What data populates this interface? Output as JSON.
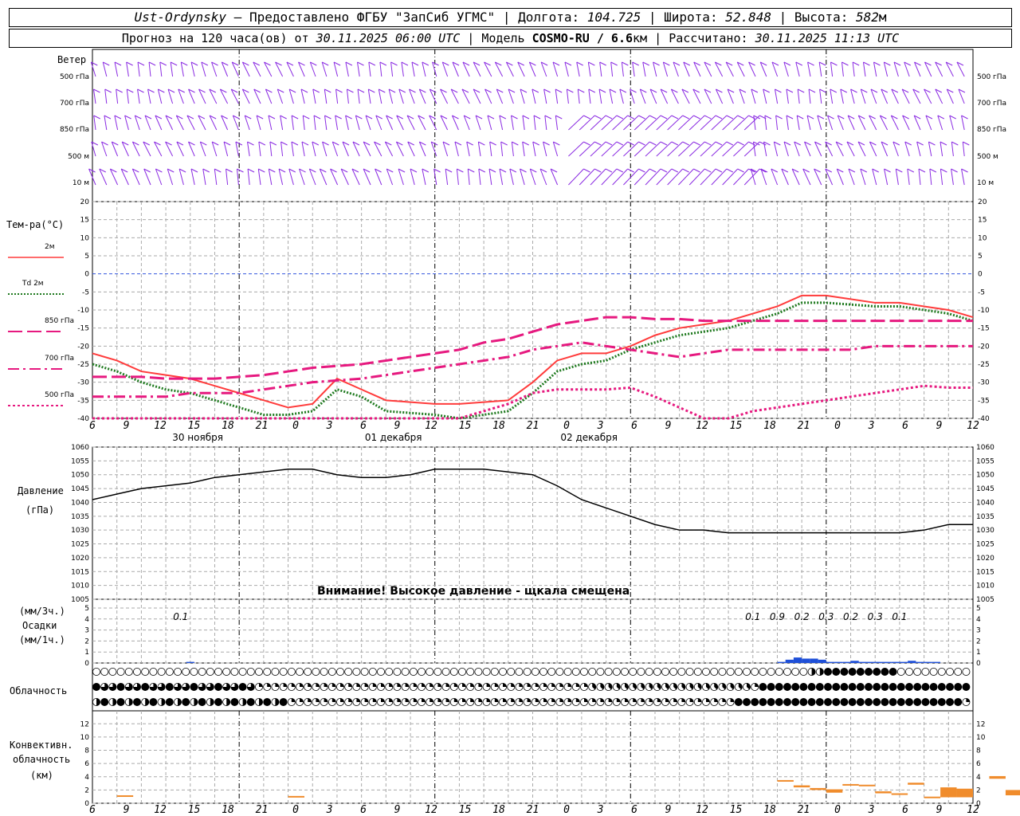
{
  "header": {
    "station": "Ust-Ordynsky",
    "provider": "Предоставлено ФГБУ \"ЗапСиб УГМС\"",
    "lon_label": "Долгота:",
    "lon": "104.725",
    "lat_label": "Широта:",
    "lat": "52.848",
    "alt_label": "Высота:",
    "alt": "582",
    "alt_unit": "м",
    "forecast_label": "Прогноз на 120 часа(ов) от",
    "forecast_from": "30.11.2025 06:00 UTC",
    "model_label": "Модель",
    "model": "COSMO-RU / 6.6",
    "model_unit": "км",
    "computed_label": "Рассчитано:",
    "computed": "30.11.2025 11:13 UTC"
  },
  "wind_panel": {
    "title": "Ветер",
    "levels": [
      "500 гПа",
      "700 гПа",
      "850 гПа",
      "500 м",
      "10 м"
    ],
    "color": "#8a2be2"
  },
  "temp_panel": {
    "title": "Тем-ра(°С)",
    "legend": [
      {
        "label": "2м",
        "color": "#ff3b3b",
        "style": "solid"
      },
      {
        "label": "Td 2м",
        "color": "#1f7a1f",
        "style": "dotted"
      },
      {
        "label": "850 гПа",
        "color": "#e6197f",
        "style": "dash"
      },
      {
        "label": "700 гПа",
        "color": "#e6197f",
        "style": "dashdot"
      },
      {
        "label": "500 гПа",
        "color": "#e6197f",
        "style": "dot"
      }
    ],
    "yticks": [
      20,
      15,
      10,
      5,
      0,
      -5,
      -10,
      -15,
      -20,
      -25,
      -30,
      -35,
      -40
    ]
  },
  "dates": [
    "30 ноября",
    "01 декабря",
    "02 декабря"
  ],
  "x_hours": [
    "6",
    "9",
    "12",
    "15",
    "18",
    "21",
    "0",
    "3",
    "6",
    "9",
    "12",
    "15",
    "18",
    "21",
    "0",
    "3",
    "6",
    "9",
    "12",
    "15",
    "18",
    "21",
    "0",
    "3",
    "6",
    "9",
    "12"
  ],
  "pressure_panel": {
    "title": "Давление",
    "unit": "(гПа)",
    "yticks": [
      1060,
      1055,
      1050,
      1045,
      1040,
      1035,
      1030,
      1025,
      1020,
      1015,
      1010,
      1005
    ],
    "note": "Внимание! Высокое давление - щкала смещена"
  },
  "precip_panel": {
    "unit3": "(мм/3ч.)",
    "title": "Осадки",
    "unit1": "(мм/1ч.)",
    "yticks": [
      5,
      4,
      3,
      2,
      1,
      0
    ],
    "labels": [
      {
        "hour": 15,
        "text": "0.1"
      },
      {
        "hour": 84,
        "text": "0.1"
      },
      {
        "hour": 87,
        "text": "0.9"
      },
      {
        "hour": 90,
        "text": "0.2"
      },
      {
        "hour": 93,
        "text": "0.3"
      },
      {
        "hour": 96,
        "text": "0.2"
      },
      {
        "hour": 99,
        "text": "0.3"
      },
      {
        "hour": 102,
        "text": "0.1"
      }
    ],
    "color": "#1e4fd8"
  },
  "cloud_panel": {
    "title": "Облачность"
  },
  "conv_panel": {
    "title1": "Конвективн.",
    "title2": "облачность",
    "unit": "(км)",
    "yticks": [
      12,
      10,
      8,
      6,
      4,
      2,
      0
    ],
    "color": "#f08c2c"
  },
  "chart_data": [
    {
      "type": "line",
      "title": "Тем-ра(°С)",
      "x_hours_from_start": [
        0,
        3,
        6,
        9,
        12,
        15,
        18,
        21,
        24,
        27,
        30,
        33,
        36,
        39,
        42,
        45,
        48,
        51,
        54,
        57,
        60,
        63,
        66,
        69,
        72,
        75,
        78,
        81,
        84,
        87,
        90,
        93,
        96,
        99,
        102,
        105,
        108
      ],
      "ylim": [
        -40,
        20
      ],
      "series": [
        {
          "name": "2м",
          "values": [
            -22,
            -24,
            -27,
            -28,
            -29,
            -31,
            -33,
            -35,
            -37,
            -36,
            -29,
            -32,
            -35,
            -35.5,
            -36,
            -36,
            -35.5,
            -35,
            -30,
            -24,
            -22,
            -22,
            -20,
            -17,
            -15,
            -14,
            -13,
            -11,
            -9,
            -6,
            -6,
            -7,
            -8,
            -8,
            -9,
            -10,
            -12
          ]
        },
        {
          "name": "Td 2м",
          "values": [
            -25,
            -27,
            -30,
            -32,
            -33,
            -35,
            -37,
            -39,
            -39,
            -38,
            -32,
            -34,
            -38,
            -38.5,
            -39,
            -40,
            -39,
            -38,
            -33,
            -27,
            -25,
            -24,
            -21,
            -19,
            -17,
            -16,
            -15,
            -13,
            -11,
            -8,
            -8,
            -8.5,
            -9,
            -9,
            -10,
            -11,
            -13
          ]
        },
        {
          "name": "850 гПа",
          "values": [
            -28.5,
            -28.5,
            -28.5,
            -29,
            -29,
            -29,
            -28.5,
            -28,
            -27,
            -26,
            -25.5,
            -25,
            -24,
            -23,
            -22,
            -21,
            -19,
            -18,
            -16,
            -14,
            -13,
            -12,
            -12,
            -12.5,
            -12.5,
            -13,
            -13,
            -13,
            -13,
            -13,
            -13,
            -13,
            -13,
            -13,
            -13,
            -13,
            -13
          ]
        },
        {
          "name": "700 гПа",
          "values": [
            -34,
            -34,
            -34,
            -34,
            -33,
            -33,
            -33,
            -32,
            -31,
            -30,
            -29.5,
            -29,
            -28,
            -27,
            -26,
            -25,
            -24,
            -23,
            -21,
            -20,
            -19,
            -20,
            -21,
            -22,
            -23,
            -22,
            -21,
            -21,
            -21,
            -21,
            -21,
            -21,
            -20,
            -20,
            -20,
            -20,
            -20
          ]
        },
        {
          "name": "500 гПа",
          "values": [
            -46,
            -46,
            -46,
            -46,
            -46,
            -46,
            -46,
            -46,
            -46,
            -46,
            -46,
            -46,
            -46,
            -46,
            -45,
            -40,
            -38,
            -36,
            -33,
            -32,
            -32,
            -32,
            -31.5,
            -34,
            -37,
            -40,
            -40,
            -38,
            -37,
            -36,
            -35,
            -34,
            -33,
            -32,
            -31,
            -31.5,
            -31.5
          ]
        }
      ]
    },
    {
      "type": "line",
      "title": "Давление",
      "ylabel": "(гПа)",
      "ylim": [
        1005,
        1060
      ],
      "x_hours_from_start": [
        0,
        3,
        6,
        9,
        12,
        15,
        18,
        21,
        24,
        27,
        30,
        33,
        36,
        39,
        42,
        45,
        48,
        51,
        54,
        57,
        60,
        63,
        66,
        69,
        72,
        75,
        78,
        81,
        84,
        87,
        90,
        93,
        96,
        99,
        102,
        105,
        108
      ],
      "series": [
        {
          "name": "Давление",
          "values": [
            1041,
            1043,
            1045,
            1046,
            1047,
            1049,
            1050,
            1051,
            1052,
            1052,
            1050,
            1049,
            1049,
            1050,
            1052,
            1052,
            1052,
            1051,
            1050,
            1046,
            1041,
            1038,
            1035,
            1032,
            1030,
            1030,
            1029,
            1029,
            1029,
            1029,
            1029,
            1029,
            1029,
            1029,
            1030,
            1032,
            1032
          ]
        }
      ]
    },
    {
      "type": "bar",
      "title": "Осадки",
      "x_hours_from_start": [
        84,
        85,
        86,
        87,
        88,
        89,
        90,
        91,
        92,
        93,
        94,
        95,
        96,
        97,
        98,
        99,
        100,
        101,
        102,
        103
      ],
      "values": [
        0.1,
        0.3,
        0.5,
        0.4,
        0.4,
        0.3,
        0.1,
        0.1,
        0.1,
        0.2,
        0.1,
        0.1,
        0.1,
        0.1,
        0.1,
        0.1,
        0.2,
        0.1,
        0.1,
        0.1
      ],
      "ylim": [
        0,
        5
      ]
    },
    {
      "type": "bar",
      "title": "Конвективн. облачность",
      "ylabel": "(км)",
      "ylim": [
        0,
        13
      ],
      "segments": [
        {
          "hour": 3,
          "base": 1.0,
          "top": 1.2
        },
        {
          "hour": 24,
          "base": 0.9,
          "top": 1.1
        },
        {
          "hour": 84,
          "base": 3.3,
          "top": 3.5
        },
        {
          "hour": 86,
          "base": 2.4,
          "top": 2.7
        },
        {
          "hour": 88,
          "base": 2.0,
          "top": 2.3
        },
        {
          "hour": 90,
          "base": 1.6,
          "top": 2.1
        },
        {
          "hour": 92,
          "base": 2.7,
          "top": 2.9
        },
        {
          "hour": 94,
          "base": 2.6,
          "top": 2.8
        },
        {
          "hour": 96,
          "base": 1.5,
          "top": 1.8
        },
        {
          "hour": 98,
          "base": 1.3,
          "top": 1.5
        },
        {
          "hour": 100,
          "base": 2.8,
          "top": 3.1
        },
        {
          "hour": 102,
          "base": 0.8,
          "top": 1.0
        },
        {
          "hour": 104,
          "base": 0.9,
          "top": 2.4
        },
        {
          "hour": 106,
          "base": 0.9,
          "top": 2.2
        },
        {
          "hour": 110,
          "base": 3.7,
          "top": 4.1
        },
        {
          "hour": 112,
          "base": 1.2,
          "top": 2.0
        },
        {
          "hour": 115,
          "base": 0.9,
          "top": 1.7
        }
      ]
    }
  ]
}
